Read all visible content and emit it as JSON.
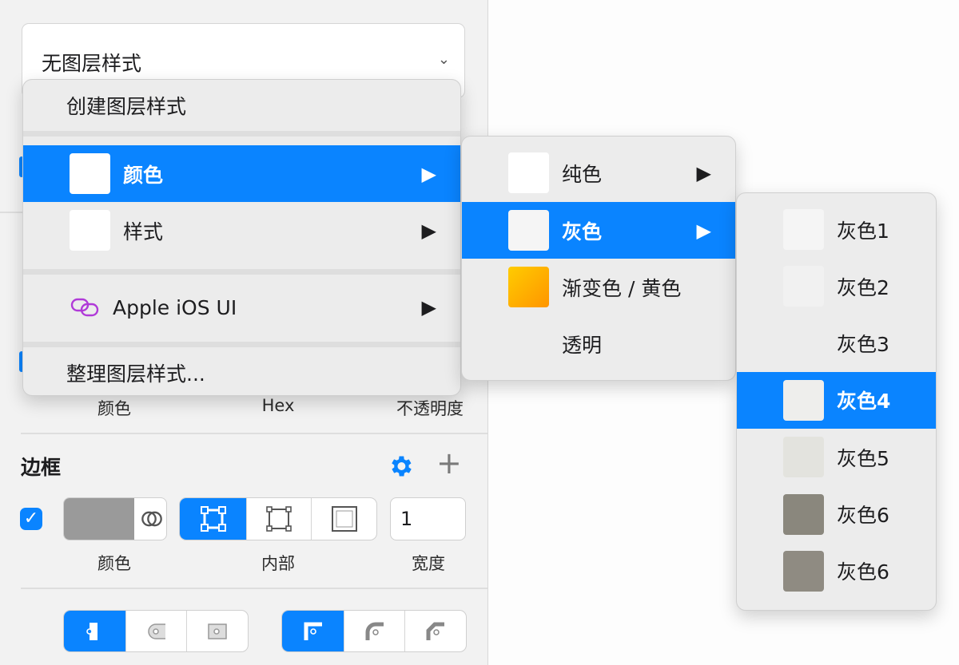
{
  "layer_style_select": {
    "value": "无图层样式"
  },
  "color_row_labels": {
    "color": "颜色",
    "hex": "Hex",
    "opacity": "不透明度"
  },
  "border_section": {
    "title": "边框",
    "enabled": true,
    "color_label": "颜色",
    "position_label": "内部",
    "width_label": "宽度",
    "width_value": "1",
    "swatch_color": "#9a9a9a"
  },
  "menu_main": {
    "create": "创建图层样式",
    "color": "颜色",
    "style": "样式",
    "library": "Apple iOS UI",
    "organize": "整理图层样式..."
  },
  "menu_color": {
    "solid": "纯色",
    "gray": "灰色",
    "gradient": "渐变色 / 黄色",
    "transparent": "透明"
  },
  "menu_gray": {
    "items": [
      {
        "label": "灰色1",
        "color": "#f5f5f5"
      },
      {
        "label": "灰色2",
        "color": "#f1f1f1"
      },
      {
        "label": "灰色3",
        "color": "#ececec"
      },
      {
        "label": "灰色4",
        "color": "#eeeeec"
      },
      {
        "label": "灰色5",
        "color": "#e3e3de"
      },
      {
        "label": "灰色6",
        "color": "#8a877d"
      },
      {
        "label": "灰色6",
        "color": "#8f8b82"
      }
    ],
    "selected_index": 3
  },
  "colors": {
    "accent": "#0a84ff",
    "library_icon": "#b03ad8",
    "gradient_start": "#ffcc00",
    "gradient_end": "#ff9500"
  }
}
